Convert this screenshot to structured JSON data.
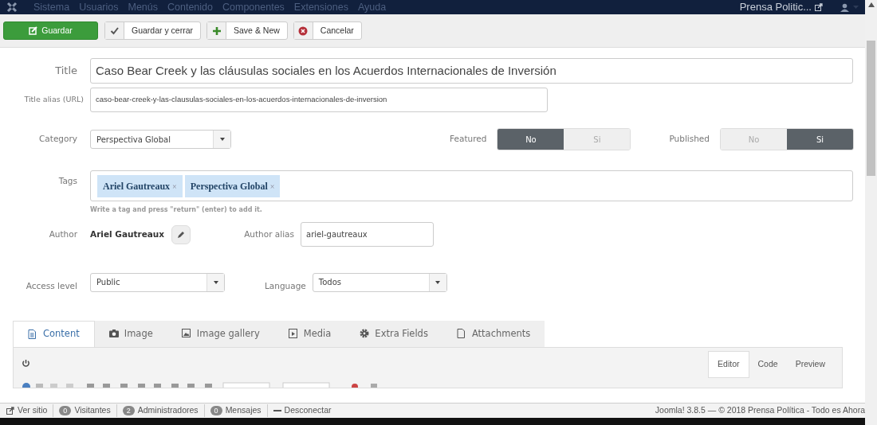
{
  "menu": {
    "items": [
      "Sistema",
      "Usuarios",
      "Menús",
      "Contenido",
      "Componentes",
      "Extensiones",
      "Ayuda"
    ],
    "site_link": "Prensa Politic..."
  },
  "toolbar": [
    {
      "label": "Guardar",
      "kind": "save"
    },
    {
      "label": "Guardar y cerrar",
      "kind": "check"
    },
    {
      "label": "Save & New",
      "kind": "plus"
    },
    {
      "label": "Cancelar",
      "kind": "cancel"
    }
  ],
  "title": {
    "label": "Title",
    "value": "Caso Bear Creek y las cláusulas sociales en los Acuerdos Internacionales de Inversión"
  },
  "alias": {
    "label": "Title alias (URL)",
    "value": "caso-bear-creek-y-las-clausulas-sociales-en-los-acuerdos-internacionales-de-inversion"
  },
  "category": {
    "label": "Category",
    "value": "Perspectiva Global"
  },
  "featured": {
    "label": "Featured",
    "options": [
      {
        "label": "No",
        "selected": true
      },
      {
        "label": "Si",
        "selected": false
      }
    ]
  },
  "published": {
    "label": "Published",
    "options": [
      {
        "label": "No",
        "selected": false
      },
      {
        "label": "Si",
        "selected": true
      }
    ]
  },
  "tags": {
    "label": "Tags",
    "items": [
      {
        "label": "Ariel Gautreaux",
        "remove": "×"
      },
      {
        "label": "Perspectiva Global",
        "remove": "×"
      }
    ],
    "hint": "Write a tag and press \"return\" (enter) to add it."
  },
  "author": {
    "label": "Author",
    "value": "Ariel Gautreaux"
  },
  "author_alias": {
    "label": "Author alias",
    "value": "ariel-gautreaux"
  },
  "access": {
    "label": "Access level",
    "value": "Public"
  },
  "language": {
    "label": "Language",
    "value": "Todos"
  },
  "tabs": [
    {
      "label": "Content",
      "kind": "doc",
      "selected": true
    },
    {
      "label": "Image",
      "kind": "camera",
      "selected": false
    },
    {
      "label": "Image gallery",
      "kind": "picture",
      "selected": false
    },
    {
      "label": "Media",
      "kind": "media",
      "selected": false
    },
    {
      "label": "Extra Fields",
      "kind": "gear",
      "selected": false
    },
    {
      "label": "Attachments",
      "kind": "file",
      "selected": false
    }
  ],
  "editor_modes": [
    {
      "label": "Editor",
      "selected": true
    },
    {
      "label": "Code",
      "selected": false
    },
    {
      "label": "Preview",
      "selected": false
    }
  ],
  "status_bar": {
    "items": [
      {
        "kind": "link",
        "label": "Ver sitio"
      },
      {
        "kind": "count",
        "count": "0",
        "label": "Visitantes"
      },
      {
        "kind": "count",
        "count": "2",
        "label": "Administradores"
      },
      {
        "kind": "count",
        "count": "0",
        "label": "Mensajes"
      },
      {
        "kind": "logout",
        "label": "Desconectar"
      }
    ],
    "right": "Joomla! 3.8.5 — © 2018 Prensa Política - Todo es Ahora"
  }
}
